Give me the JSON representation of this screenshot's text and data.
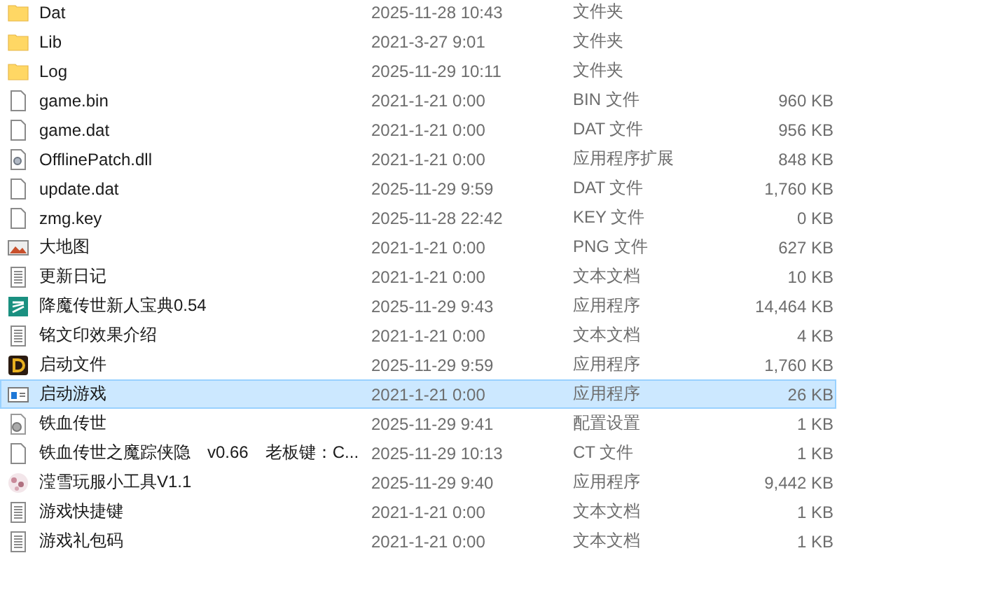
{
  "files": [
    {
      "name": "Dat",
      "modified": "2025-11-28 10:43",
      "type": "文件夹",
      "kind": "folder",
      "selected": false
    },
    {
      "name": "Lib",
      "modified": "2021-3-27 9:01",
      "type": "文件夹",
      "kind": "folder",
      "selected": false
    },
    {
      "name": "Log",
      "modified": "2025-11-29 10:11",
      "type": "文件夹",
      "kind": "folder",
      "selected": false
    },
    {
      "name": "game.bin",
      "modified": "2021-1-21 0:00",
      "type": "BIN 文件",
      "size": "960 KB",
      "kind": "file",
      "selected": false
    },
    {
      "name": "game.dat",
      "modified": "2021-1-21 0:00",
      "type": "DAT 文件",
      "size": "956 KB",
      "kind": "file",
      "selected": false
    },
    {
      "name": "OfflinePatch.dll",
      "modified": "2021-1-21 0:00",
      "type": "应用程序扩展",
      "size": "848 KB",
      "kind": "library",
      "selected": false
    },
    {
      "name": "update.dat",
      "modified": "2025-11-29 9:59",
      "type": "DAT 文件",
      "size": "1,760 KB",
      "kind": "file",
      "selected": false
    },
    {
      "name": "zmg.key",
      "modified": "2025-11-28 22:42",
      "type": "KEY 文件",
      "size": "0 KB",
      "kind": "file",
      "selected": false
    },
    {
      "name": "大地图",
      "modified": "2021-1-21 0:00",
      "type": "PNG 文件",
      "size": "627 KB",
      "kind": "image",
      "selected": false
    },
    {
      "name": "更新日记",
      "modified": "2021-1-21 0:00",
      "type": "文本文档",
      "size": "10 KB",
      "kind": "text",
      "selected": false
    },
    {
      "name": "降魔传世新人宝典0.54",
      "modified": "2025-11-29 9:43",
      "type": "应用程序",
      "size": "14,464 KB",
      "kind": "app-tile",
      "selected": false
    },
    {
      "name": "铭文印效果介绍",
      "modified": "2021-1-21 0:00",
      "type": "文本文档",
      "size": "4 KB",
      "kind": "text",
      "selected": false
    },
    {
      "name": "启动文件",
      "modified": "2025-11-29 9:59",
      "type": "应用程序",
      "size": "1,760 KB",
      "kind": "app-letter",
      "selected": false
    },
    {
      "name": "启动游戏",
      "modified": "2021-1-21 0:00",
      "type": "应用程序",
      "size": "26 KB",
      "kind": "app-window",
      "selected": true
    },
    {
      "name": "铁血传世",
      "modified": "2025-11-29 9:41",
      "type": "配置设置",
      "size": "1 KB",
      "kind": "settings",
      "selected": false
    },
    {
      "name": "铁血传世之魔踪侠隐　v0.66　老板键：C...",
      "modified": "2025-11-29 10:13",
      "type": "CT 文件",
      "size": "1 KB",
      "kind": "file",
      "selected": false
    },
    {
      "name": "滢雪玩服小工具V1.1",
      "modified": "2025-11-29 9:40",
      "type": "应用程序",
      "size": "9,442 KB",
      "kind": "app-flower",
      "selected": false
    },
    {
      "name": "游戏快捷键",
      "modified": "2021-1-21 0:00",
      "type": "文本文档",
      "size": "1 KB",
      "kind": "text",
      "selected": false
    },
    {
      "name": "游戏礼包码",
      "modified": "2021-1-21 0:00",
      "type": "文本文档",
      "size": "1 KB",
      "kind": "text",
      "selected": false
    }
  ]
}
